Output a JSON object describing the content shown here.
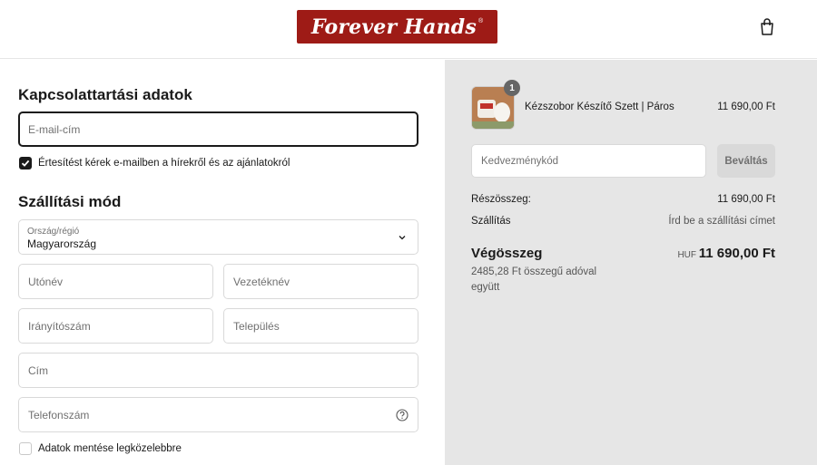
{
  "header": {
    "logo_text": "Forever Hands",
    "logo_mark": "®",
    "logo_color": "#9e1b16"
  },
  "contact": {
    "title": "Kapcsolattartási adatok",
    "email_placeholder": "E-mail-cím",
    "newsletter_label": "Értesítést kérek e-mailben a hírekről és az ajánlatokról",
    "newsletter_checked": true
  },
  "shipping": {
    "title": "Szállítási mód",
    "country_label": "Ország/régió",
    "country_value": "Magyarország",
    "first_name_placeholder": "Utónév",
    "last_name_placeholder": "Vezetéknév",
    "zip_placeholder": "Irányítószám",
    "city_placeholder": "Település",
    "address_placeholder": "Cím",
    "phone_placeholder": "Telefonszám",
    "save_label": "Adatok mentése legközelebbre",
    "save_checked": false
  },
  "summary": {
    "item": {
      "quantity": "1",
      "name": "Kézszobor Készítő Szett | Páros",
      "price": "11 690,00 Ft"
    },
    "discount_placeholder": "Kedvezménykód",
    "apply_label": "Beváltás",
    "subtotal_label": "Részösszeg:",
    "subtotal_value": "11 690,00 Ft",
    "shipping_label": "Szállítás",
    "shipping_value": "Írd be a szállítási címet",
    "total_label": "Végösszeg",
    "total_currency": "HUF",
    "total_value": "11 690,00 Ft",
    "tax_note": "2485,28 Ft összegű adóval együtt"
  }
}
